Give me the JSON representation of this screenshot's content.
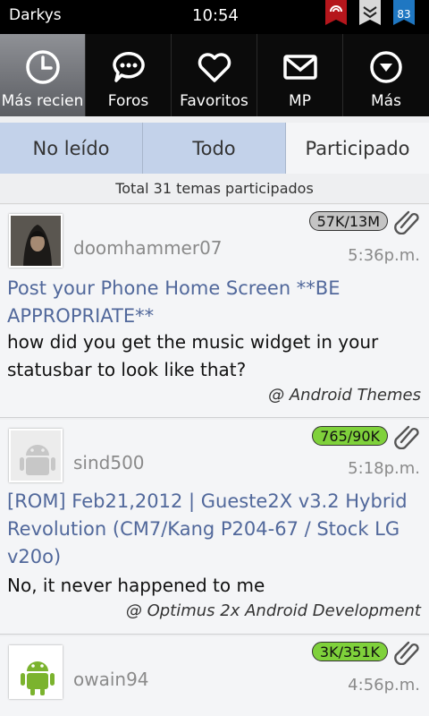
{
  "statusbar": {
    "app_name": "Darkys",
    "time": "10:54",
    "notification_count": "83",
    "colors": {
      "flag1": "#b5161c",
      "flag2": "#d8d8d8",
      "flag3": "#1f77c2"
    }
  },
  "nav": {
    "items": [
      {
        "label": "Más recien",
        "icon": "clock-icon",
        "active": true
      },
      {
        "label": "Foros",
        "icon": "chat-bubble-icon",
        "active": false
      },
      {
        "label": "Favoritos",
        "icon": "heart-icon",
        "active": false
      },
      {
        "label": "MP",
        "icon": "envelope-icon",
        "active": false
      },
      {
        "label": "Más",
        "icon": "chevron-down-circle-icon",
        "active": false
      }
    ]
  },
  "tabs": [
    {
      "label": "No leído",
      "selected": false
    },
    {
      "label": "Todo",
      "selected": false
    },
    {
      "label": "Participado",
      "selected": true
    }
  ],
  "summary": "Total 31 temas participados",
  "topics": [
    {
      "username": "doomhammer07",
      "time": "5:36p.m.",
      "stats": "57K/13M",
      "badge_color": "gray",
      "title": "Post your Phone Home Screen  **BE APPROPRIATE**",
      "snippet": "how did you get the music widget in your statusbar to look like that?",
      "forum": "@ Android Themes"
    },
    {
      "username": "sind500",
      "time": "5:18p.m.",
      "stats": "765/90K",
      "badge_color": "green",
      "title": "[ROM] Feb21,2012 | Gueste2X v3.2 Hybrid Revolution (CM7/Kang P204-67 / Stock LG v20o)",
      "snippet": "No, it never happened to me",
      "forum": "@ Optimus 2x Android Development"
    },
    {
      "username": "owain94",
      "time": "4:56p.m.",
      "stats": "3K/351K",
      "badge_color": "green",
      "title": "",
      "snippet": "",
      "forum": ""
    }
  ],
  "colors": {
    "accent_tab": "#c3d2ea",
    "title_text": "#51689b",
    "badge_green": "#7fd13b",
    "badge_gray": "#c4c4c4"
  }
}
